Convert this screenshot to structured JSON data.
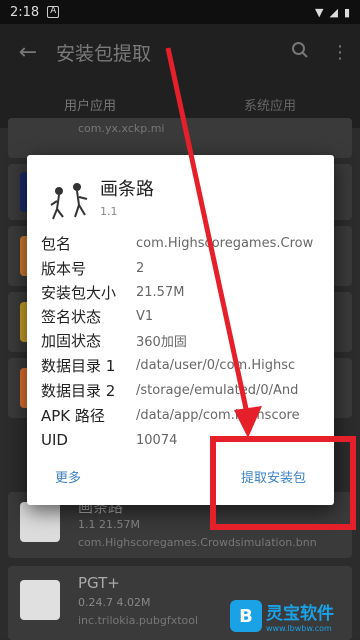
{
  "status_bar": {
    "time": "2:18",
    "notif_icon": "A"
  },
  "app_bar": {
    "title": "安装包提取"
  },
  "tabs": [
    {
      "label": "用户应用"
    },
    {
      "label": "系统应用"
    }
  ],
  "background_list": [
    {
      "name": "",
      "meta": "",
      "pkg": "com.yx.xckp.mi"
    },
    {
      "name": "画条路",
      "meta": "1.1   21.57M",
      "pkg": "com.Highscoregames.Crowdsimulation.bnn"
    },
    {
      "name": "PGT+",
      "meta": "0.24.7   4.02M",
      "pkg": "inc.trilokia.pubgfxtool"
    }
  ],
  "dialog": {
    "app_name": "画条路",
    "version": "1.1",
    "rows": [
      {
        "key": "包名",
        "value": "com.Highscoregames.Crow"
      },
      {
        "key": "版本号",
        "value": "2"
      },
      {
        "key": "安装包大小",
        "value": "21.57M"
      },
      {
        "key": "签名状态",
        "value": "V1"
      },
      {
        "key": "加固状态",
        "value": "360加固"
      },
      {
        "key": "数据目录 1",
        "value": "/data/user/0/com.Highsc"
      },
      {
        "key": "数据目录 2",
        "value": "/storage/emulated/0/And"
      },
      {
        "key": "APK 路径",
        "value": "/data/app/com.Highscore"
      },
      {
        "key": "UID",
        "value": "10074"
      }
    ],
    "more_label": "更多",
    "extract_label": "提取安装包"
  },
  "watermark": {
    "name": "灵宝软件",
    "url": "www.lbwbw.com",
    "logo": "B"
  },
  "colors": {
    "accent": "#3b82c4",
    "annotation": "#e5202a",
    "watermark": "#1aa1e6"
  }
}
